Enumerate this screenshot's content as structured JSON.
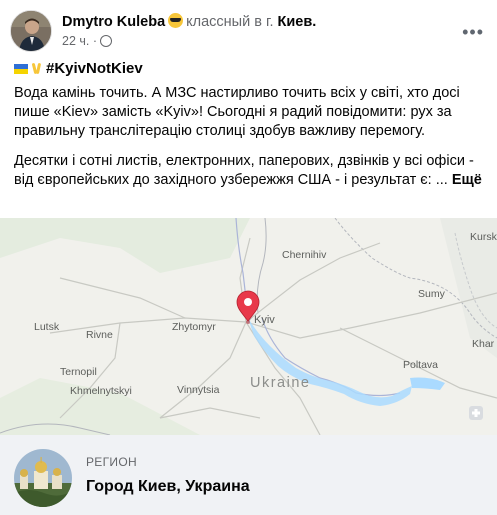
{
  "post": {
    "author_name": "Dmytro Kuleba",
    "activity_text": "классный в г.",
    "place": "Киев.",
    "time": "22 ч.",
    "more_icon": "more-options-icon",
    "hashtag": "#KyivNotKiev",
    "paragraph1": "Вода камінь точить. А МЗС настирливо точить всіх у світі, хто досі пише «Kiev» замість «Kyiv»! Сьогодні я радий повідомити: рух за правильну транслітерацію столиці здобув важливу перемогу.",
    "paragraph2": "Десятки і сотні листів, електронних, паперових, дзвінків у всі офіси - від європейських до західного узбережжя США - і результат є: ...",
    "see_more": "Ещё"
  },
  "map": {
    "labels": {
      "chernihiv": "Chernihiv",
      "lutsk": "Lutsk",
      "rivne": "Rivne",
      "zhytomyr": "Zhytomyr",
      "kyiv": "Kyiv",
      "sumy": "Sumy",
      "kursk": "Kursk",
      "ternopil": "Ternopil",
      "khmelnytskyi": "Khmelnytskyi",
      "vinnytsia": "Vinnytsia",
      "ukraine": "Ukraine",
      "poltava": "Poltava",
      "kharkiv": "Khar"
    },
    "pin_color": "#e8394a"
  },
  "region": {
    "label": "РЕГИОН",
    "name": "Город Киев, Украина"
  }
}
